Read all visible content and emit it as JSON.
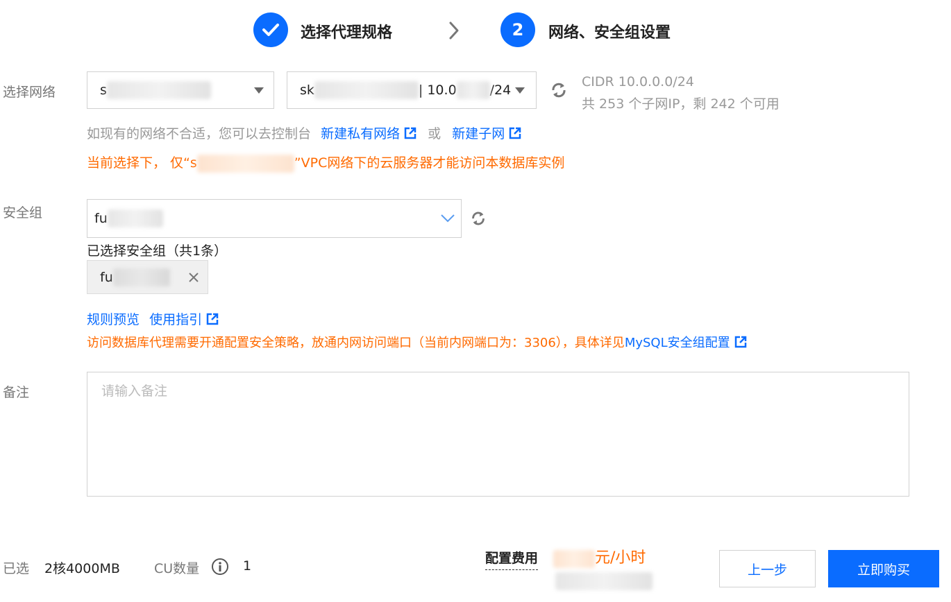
{
  "steps": [
    {
      "index": "✓",
      "label": "选择代理规格",
      "state": "done"
    },
    {
      "index": "2",
      "label": "网络、安全组设置",
      "state": "current"
    }
  ],
  "network": {
    "label": "选择网络",
    "vpc_value_prefix": "s",
    "subnet_value_prefix": "sk",
    "subnet_value_mid": "| 10.0",
    "subnet_value_suffix": "/24",
    "cidr_line": "CIDR 10.0.0.0/24",
    "ip_line": "共 253 个子网IP，剩 242 个可用",
    "hint_prefix": "如现有的网络不合适，您可以去控制台",
    "new_vpc_link": "新建私有网络",
    "or_text": "或",
    "new_subnet_link": "新建子网",
    "warning_prefix": "当前选择下，  仅“s",
    "warning_suffix": "”VPC网络下的云服务器才能访问本数据库实例"
  },
  "security_group": {
    "label": "安全组",
    "select_value_prefix": "fu",
    "selected_heading": "已选择安全组（共1条）",
    "tag_prefix": "fu",
    "rules_preview_link": "规则预览",
    "usage_guide_link": "使用指引",
    "warning_text": "访问数据库代理需要开通配置安全策略，放通内网访问端口（当前内网端口为：3306），具体详见",
    "mysql_sg_link": "MySQL安全组配置"
  },
  "remark": {
    "label": "备注",
    "placeholder": "请输入备注"
  },
  "footer": {
    "selected_label": "已选",
    "selected_value": "2核4000MB",
    "cu_label": "CU数量",
    "cu_value": "1",
    "fee_label": "配置费用",
    "fee_unit": "元/小时",
    "prev_button": "上一步",
    "buy_button": "立即购买"
  },
  "colors": {
    "primary": "#0a6cff",
    "warning": "#ff6a00"
  }
}
